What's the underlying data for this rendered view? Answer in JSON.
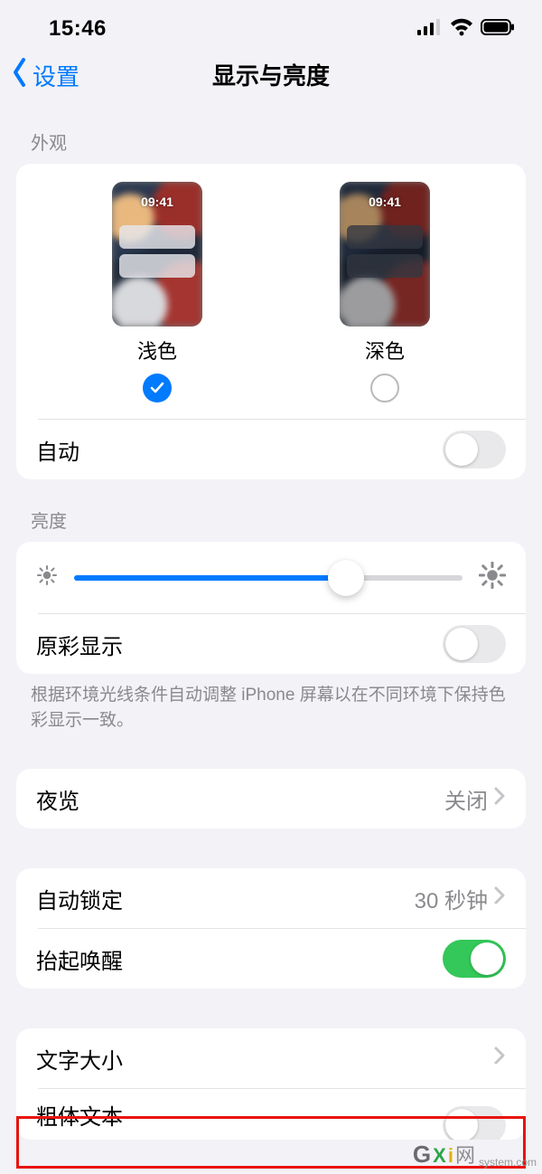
{
  "status": {
    "time": "15:46"
  },
  "nav": {
    "back": "设置",
    "title": "显示与亮度"
  },
  "appearance": {
    "header": "外观",
    "thumb_time": "09:41",
    "light_label": "浅色",
    "dark_label": "深色",
    "selected": "light",
    "auto_label": "自动",
    "auto_on": false
  },
  "brightness": {
    "header": "亮度",
    "value_percent": 70,
    "truetone_label": "原彩显示",
    "truetone_on": false,
    "truetone_footer": "根据环境光线条件自动调整 iPhone 屏幕以在不同环境下保持色彩显示一致。"
  },
  "nightshift": {
    "label": "夜览",
    "value": "关闭"
  },
  "autolock": {
    "label": "自动锁定",
    "value": "30 秒钟"
  },
  "raise": {
    "label": "抬起唤醒",
    "on": true
  },
  "text": {
    "size_label": "文字大小",
    "bold_label": "粗体文本",
    "bold_on": false
  },
  "watermark": {
    "brand_cn": "网",
    "domain": "system.com"
  }
}
